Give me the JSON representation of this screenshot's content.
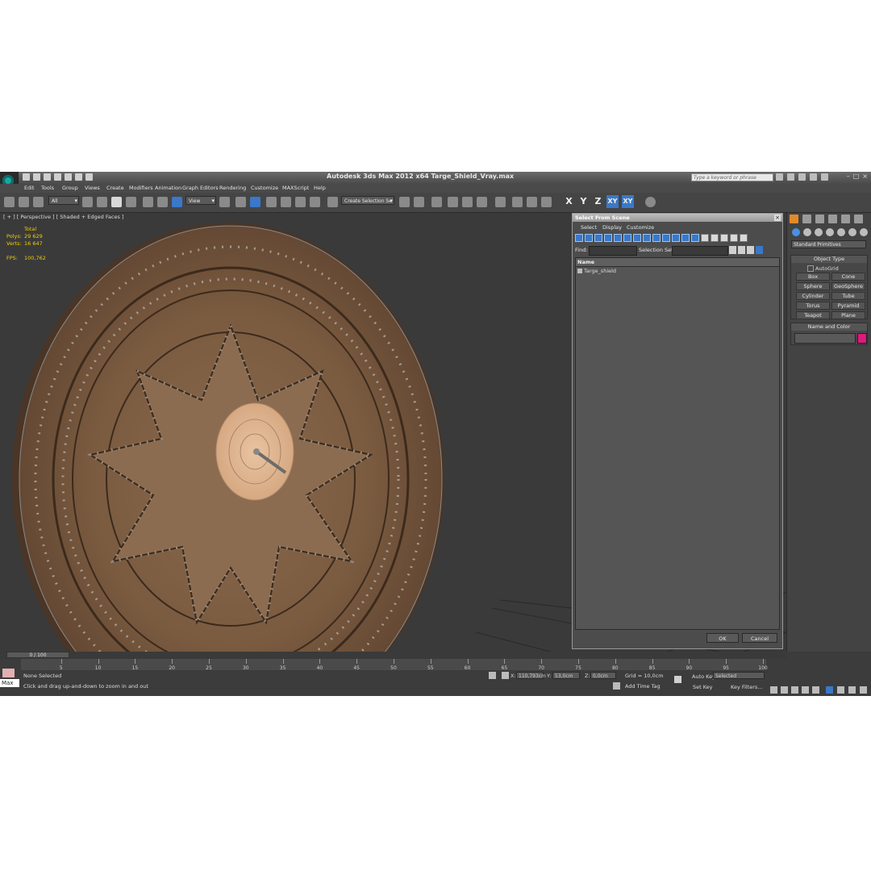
{
  "app": {
    "title": "Autodesk 3ds Max  2012 x64     Targe_Shield_Vray.max",
    "search_placeholder": "Type a keyword or phrase"
  },
  "menu": [
    "Edit",
    "Tools",
    "Group",
    "Views",
    "Create",
    "Modifiers",
    "Animation",
    "Graph Editors",
    "Rendering",
    "Customize",
    "MAXScript",
    "Help"
  ],
  "toolbar": {
    "filter_value": "All",
    "refcoord_value": "View",
    "selection_set_value": "Create Selection Se",
    "axes": [
      "X",
      "Y",
      "Z",
      "XY",
      "XY"
    ]
  },
  "viewport": {
    "label": "[ + ] [ Perspective ] [ Shaded + Edged Faces ]",
    "stats_header": "Total",
    "stats": [
      {
        "key": "Polys:",
        "value": "29 629"
      },
      {
        "key": "Verts:",
        "value": "16 647"
      },
      {
        "key": "FPS:",
        "value": "100,762"
      }
    ]
  },
  "dialog": {
    "title": "Select From Scene",
    "menu": [
      "Select",
      "Display",
      "Customize"
    ],
    "find_label": "Find:",
    "selection_set_label": "Selection Set:",
    "column_name": "Name",
    "items": [
      "Targe_shield"
    ],
    "ok_label": "OK",
    "cancel_label": "Cancel"
  },
  "command_panel": {
    "category": "Standard Primitives",
    "object_type_title": "Object Type",
    "autogrid_label": "AutoGrid",
    "buttons": [
      "Box",
      "Cone",
      "Sphere",
      "GeoSphere",
      "Cylinder",
      "Tube",
      "Torus",
      "Pyramid",
      "Teapot",
      "Plane"
    ],
    "name_color_title": "Name and Color",
    "object_color": "#e0187e"
  },
  "timeline": {
    "frame_counter": "0 / 100",
    "ticks": [
      "5",
      "10",
      "15",
      "20",
      "25",
      "30",
      "35",
      "40",
      "45",
      "50",
      "55",
      "60",
      "65",
      "70",
      "75",
      "80",
      "85",
      "90",
      "95",
      "100"
    ]
  },
  "status": {
    "selection": "None Selected",
    "prompt": "Click and drag up-and-down to zoom in and out",
    "x_label": "X:",
    "x_value": "110,793cm",
    "y_label": "Y:",
    "y_value": "53,0cm",
    "z_label": "Z:",
    "z_value": "0,0cm",
    "grid": "Grid = 10,0cm",
    "add_time_tag": "Add Time Tag",
    "auto_key": "Auto Key",
    "set_key": "Set Key",
    "key_mode": "Selected",
    "key_filters": "Key Filters...",
    "current_frame": "0",
    "maxscript_label": "Max"
  }
}
